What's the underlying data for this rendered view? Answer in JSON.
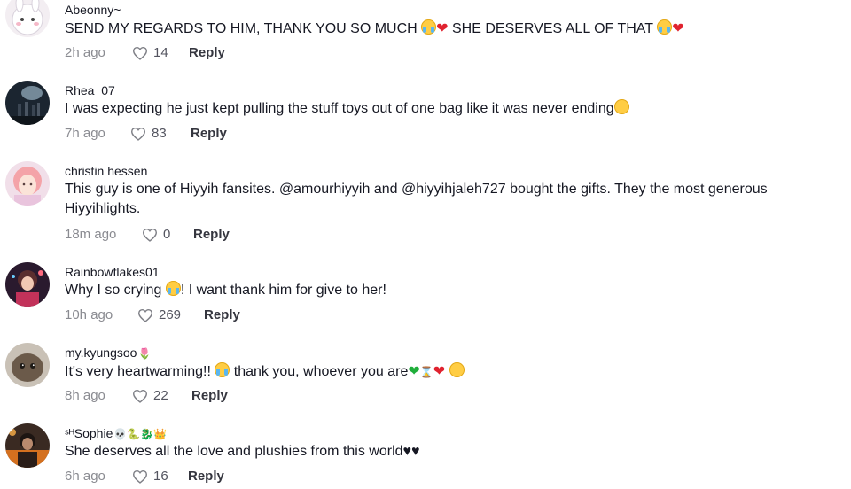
{
  "colors": {
    "text": "#161823",
    "meta": "#8a8b91",
    "heart_outline": "#7f8087",
    "red_heart": "#e0222f",
    "green_heart": "#1fae3a"
  },
  "icons": {
    "like": "heart-outline-icon",
    "crying": "loudly-crying-face-icon",
    "red_heart": "red-heart-icon",
    "green_heart": "green-heart-icon"
  },
  "reply_label": "Reply",
  "comments": [
    {
      "username": "Abeonny~",
      "text_parts": [
        "SEND MY REGARDS TO HIM, THANK YOU SO MUCH ",
        " SHE DESERVES ALL OF THAT "
      ],
      "time": "2h ago",
      "likes": "14"
    },
    {
      "username": "Rhea_07",
      "text": "I was expecting he just kept pulling the stuff toys out of one bag like it was never ending",
      "time": "7h ago",
      "likes": "83"
    },
    {
      "username": "christin hessen",
      "text": "This guy is one of Hiyyih fansites. @amourhiyyih and @hiyyihjaleh727 bought the gifts. They the most generous Hiyyihlights.",
      "time": "18m ago",
      "likes": "0"
    },
    {
      "username": "Rainbowflakes01",
      "text_parts": [
        "Why I so crying ",
        "! I want thank him for give to her!"
      ],
      "time": "10h ago",
      "likes": "269"
    },
    {
      "username": "my.kyungsoo",
      "username_emoji": "🌷",
      "text_parts": [
        "It's very heartwarming!! ",
        " thank you, whoever you are"
      ],
      "time": "8h ago",
      "likes": "22"
    },
    {
      "username": "ˢᴴSophie",
      "username_emoji": "💀🐍🐉👑",
      "text": "She deserves all the love and plushies from this world♥♥",
      "time": "6h ago",
      "likes": "16"
    }
  ]
}
